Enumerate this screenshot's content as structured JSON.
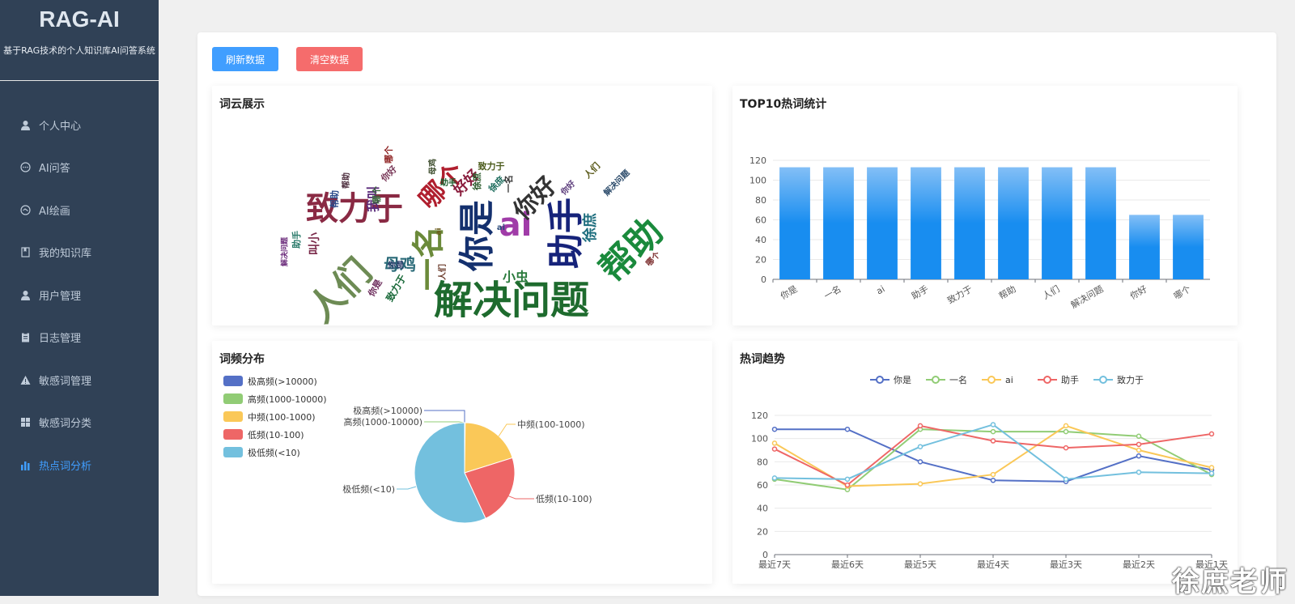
{
  "app": {
    "title": "RAG-AI",
    "subtitle": "基于RAG技术的个人知识库AI问答系统"
  },
  "sidebar": {
    "items": [
      {
        "label": "个人中心",
        "icon": "user-icon"
      },
      {
        "label": "AI问答",
        "icon": "chat-icon"
      },
      {
        "label": "AI绘画",
        "icon": "palette-icon"
      },
      {
        "label": "我的知识库",
        "icon": "book-icon"
      },
      {
        "label": "用户管理",
        "icon": "user-icon"
      },
      {
        "label": "日志管理",
        "icon": "clipboard-icon"
      },
      {
        "label": "敏感词管理",
        "icon": "warning-icon"
      },
      {
        "label": "敏感词分类",
        "icon": "grid-icon"
      },
      {
        "label": "热点词分析",
        "icon": "bar-chart-icon",
        "active": true
      }
    ]
  },
  "toolbar": {
    "refresh_label": "刷新数据",
    "clear_label": "清空数据"
  },
  "panels": {
    "wordcloud_title": "词云展示",
    "top10_title": "TOP10热词统计",
    "freq_title": "词频分布",
    "trend_title": "热词趋势"
  },
  "wordcloud": {
    "words": [
      {
        "text": "解决问题",
        "color": "#1e6b2e"
      },
      {
        "text": "致力于",
        "color": "#8a2a44"
      },
      {
        "text": "人们",
        "color": "#6d8b54"
      },
      {
        "text": "一名",
        "color": "#6b8a3a"
      },
      {
        "text": "你是",
        "color": "#14306e"
      },
      {
        "text": "ai",
        "color": "#a03ca8"
      },
      {
        "text": "助手",
        "color": "#16237a"
      },
      {
        "text": "帮助",
        "color": "#1a8a3c"
      },
      {
        "text": "哪个",
        "color": "#b01e2e"
      },
      {
        "text": "你好",
        "color": "#333"
      },
      {
        "text": "母鸡",
        "color": "#2a6a78"
      },
      {
        "text": "小虫",
        "color": "#2a7a3c"
      },
      {
        "text": "徐庶",
        "color": "#1e6e7e"
      },
      {
        "text": "好好",
        "color": "#8a1e3e"
      },
      {
        "text": "我叫",
        "color": "#5a2a7a"
      },
      {
        "text": "叫小",
        "color": "#7a2a4a"
      },
      {
        "text": "帮助",
        "color": "#2a4a8a"
      },
      {
        "text": "致力于",
        "color": "#4a5a1a"
      },
      {
        "text": "解决问题",
        "color": "#6a2a7a"
      },
      {
        "text": "助手",
        "color": "#2a7a6a"
      },
      {
        "text": "你是",
        "color": "#2a3a6a"
      },
      {
        "text": "人们",
        "color": "#6a3a2a"
      },
      {
        "text": "哪个",
        "color": "#7a2a2a"
      },
      {
        "text": "一名",
        "color": "#3a3a3a"
      },
      {
        "text": "你好",
        "color": "#5a3a7a"
      },
      {
        "text": "徐庶",
        "color": "#2a5a2a"
      },
      {
        "text": "母鸡",
        "color": "#3a4a2a"
      },
      {
        "text": "助手",
        "color": "#1a5a2a"
      },
      {
        "text": "ai",
        "color": "#6a5a1a"
      },
      {
        "text": "ai",
        "color": "#2a4a7a"
      },
      {
        "text": "致力于",
        "color": "#1a6a3a"
      },
      {
        "text": "你是",
        "color": "#6a2a5a"
      },
      {
        "text": "帮助",
        "color": "#4a2a3a"
      },
      {
        "text": "哪个",
        "color": "#3a6a3a"
      },
      {
        "text": "人们",
        "color": "#5a5a1a"
      },
      {
        "text": "哪个",
        "color": "#8a1a1a"
      },
      {
        "text": "解决问题",
        "color": "#2a4a6a"
      },
      {
        "text": "你好",
        "color": "#7a3a5a"
      },
      {
        "text": "徐庶",
        "color": "#1a6a5a"
      }
    ]
  },
  "chart_data": [
    {
      "type": "bar",
      "title": "TOP10热词统计",
      "categories": [
        "你是",
        "一名",
        "ai",
        "助手",
        "致力于",
        "帮助",
        "人们",
        "解决问题",
        "你好",
        "哪个"
      ],
      "values": [
        113,
        113,
        113,
        113,
        113,
        113,
        113,
        113,
        65,
        65
      ],
      "ylim": [
        0,
        120
      ],
      "yticks": [
        0,
        20,
        40,
        60,
        80,
        100,
        120
      ],
      "color": "#1e8ceb"
    },
    {
      "type": "pie",
      "title": "词频分布",
      "slices": [
        {
          "label": "极高频(>10000)",
          "value": 0.1,
          "color": "#5470c6"
        },
        {
          "label": "高频(1000-10000)",
          "value": 0.1,
          "color": "#91cc75"
        },
        {
          "label": "中频(100-1000)",
          "value": 20,
          "color": "#fac858"
        },
        {
          "label": "低频(10-100)",
          "value": 23,
          "color": "#ee6666"
        },
        {
          "label": "极低频(<10)",
          "value": 57,
          "color": "#73c0de"
        }
      ],
      "legend": "left"
    },
    {
      "type": "line",
      "title": "热词趋势",
      "categories": [
        "最近7天",
        "最近6天",
        "最近5天",
        "最近4天",
        "最近3天",
        "最近2天",
        "最近1天"
      ],
      "ylim": [
        0,
        120
      ],
      "yticks": [
        0,
        20,
        40,
        60,
        80,
        100,
        120
      ],
      "legend": "top",
      "series": [
        {
          "name": "你是",
          "color": "#5470c6",
          "values": [
            108,
            108,
            80,
            64,
            63,
            85,
            73
          ]
        },
        {
          "name": "一名",
          "color": "#91cc75",
          "values": [
            65,
            56,
            108,
            106,
            106,
            102,
            69
          ]
        },
        {
          "name": "ai",
          "color": "#fac858",
          "values": [
            96,
            59,
            61,
            69,
            111,
            90,
            75
          ]
        },
        {
          "name": "助手",
          "color": "#ee6666",
          "values": [
            91,
            60,
            111,
            98,
            92,
            95,
            104
          ]
        },
        {
          "name": "致力于",
          "color": "#73c0de",
          "values": [
            66,
            65,
            93,
            112,
            65,
            71,
            70
          ]
        }
      ]
    }
  ],
  "watermark": "徐庶老师"
}
